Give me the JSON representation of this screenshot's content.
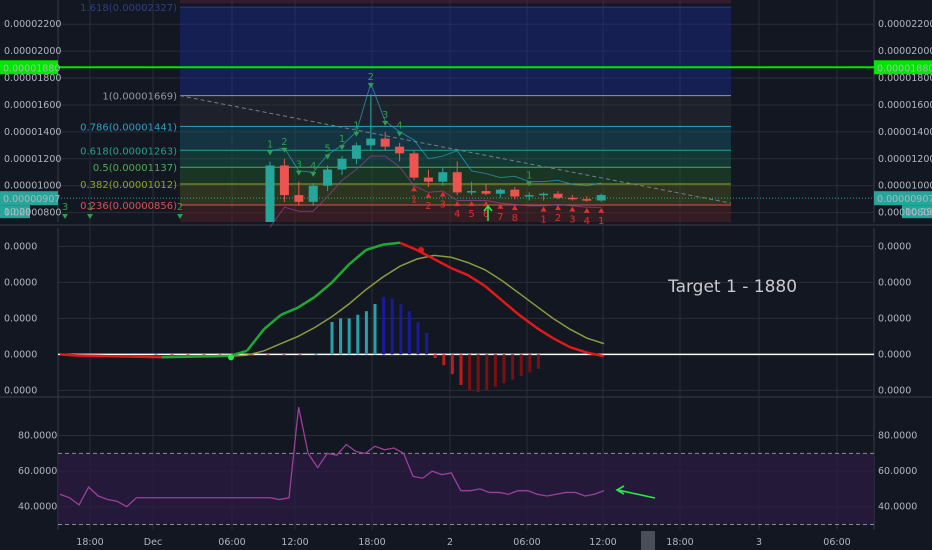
{
  "annotation": "Target 1 - 1880",
  "colors": {
    "background": "#131722",
    "grid": "#2a2e39",
    "bull": "#26a69a",
    "bear": "#ef5350",
    "target_line": "#00e600",
    "price_badge": "#26a69a",
    "macd_line_up": "#1eaa32",
    "macd_line_down": "#e01919",
    "signal_line": "#8c9a3c",
    "rsi": "#9c3f9c"
  },
  "chart_data": [
    {
      "type": "candlestick",
      "pane": "price",
      "y_ticks": [
        "0.00002200",
        "0.00002000",
        "0.00001800",
        "0.00001600",
        "0.00001400",
        "0.00001200",
        "0.00001000",
        "0.00000800"
      ],
      "ylim": [
        7.3e-06,
        2.38e-05
      ],
      "target_line": {
        "value": 1.88e-05,
        "label": "0.00001880"
      },
      "last_price": {
        "value": 9.07e-06,
        "label": "0.00000907"
      },
      "countdown": "10:29",
      "fib_levels": [
        {
          "label": "1.618(0.00002327)",
          "value": 2.327e-05,
          "color": "#2f3d8c"
        },
        {
          "label": "1(0.00001669)",
          "value": 1.669e-05,
          "color": "#9598a1"
        },
        {
          "label": "0.786(0.00001441)",
          "value": 1.441e-05,
          "color": "#2aa1c0"
        },
        {
          "label": "0.618(0.00001263)",
          "value": 1.263e-05,
          "color": "#20a48c"
        },
        {
          "label": "0.5(0.00001137)",
          "value": 1.137e-05,
          "color": "#4caf50"
        },
        {
          "label": "0.382(0.00001012)",
          "value": 1.012e-05,
          "color": "#8ca82e"
        },
        {
          "label": "0.236(0.00000856)",
          "value": 8.56e-06,
          "color": "#e05050"
        }
      ],
      "candles": [
        {
          "o": 7.3e-06,
          "h": 1.18e-05,
          "l": 7.3e-06,
          "c": 1.15e-05
        },
        {
          "o": 1.15e-05,
          "h": 1.2e-05,
          "l": 8.8e-06,
          "c": 9.3e-06
        },
        {
          "o": 9.3e-06,
          "h": 1.03e-05,
          "l": 8.5e-06,
          "c": 8.8e-06
        },
        {
          "o": 8.8e-06,
          "h": 1.02e-05,
          "l": 8.5e-06,
          "c": 1e-05
        },
        {
          "o": 1e-05,
          "h": 1.15e-05,
          "l": 9.6e-06,
          "c": 1.12e-05
        },
        {
          "o": 1.12e-05,
          "h": 1.22e-05,
          "l": 1.08e-05,
          "c": 1.2e-05
        },
        {
          "o": 1.2e-05,
          "h": 1.32e-05,
          "l": 1.16e-05,
          "c": 1.3e-05
        },
        {
          "o": 1.3e-05,
          "h": 1.68e-05,
          "l": 1.26e-05,
          "c": 1.35e-05
        },
        {
          "o": 1.35e-05,
          "h": 1.4e-05,
          "l": 1.26e-05,
          "c": 1.29e-05
        },
        {
          "o": 1.29e-05,
          "h": 1.32e-05,
          "l": 1.18e-05,
          "c": 1.24e-05
        },
        {
          "o": 1.24e-05,
          "h": 1.26e-05,
          "l": 1.04e-05,
          "c": 1.06e-05
        },
        {
          "o": 1.06e-05,
          "h": 1.12e-05,
          "l": 9.9e-06,
          "c": 1.03e-05
        },
        {
          "o": 1.03e-05,
          "h": 1.14e-05,
          "l": 1e-05,
          "c": 1.1e-05
        },
        {
          "o": 1.1e-05,
          "h": 1.18e-05,
          "l": 9.3e-06,
          "c": 9.5e-06
        },
        {
          "o": 9.5e-06,
          "h": 1.03e-05,
          "l": 9.3e-06,
          "c": 9.6e-06
        },
        {
          "o": 9.6e-06,
          "h": 1.01e-05,
          "l": 9.3e-06,
          "c": 9.4e-06
        },
        {
          "o": 9.4e-06,
          "h": 9.8e-06,
          "l": 9.1e-06,
          "c": 9.7e-06
        },
        {
          "o": 9.7e-06,
          "h": 9.9e-06,
          "l": 9e-06,
          "c": 9.2e-06
        },
        {
          "o": 9.2e-06,
          "h": 9.5e-06,
          "l": 8.9e-06,
          "c": 9.3e-06
        },
        {
          "o": 9.3e-06,
          "h": 9.5e-06,
          "l": 8.9e-06,
          "c": 9.4e-06
        },
        {
          "o": 9.4e-06,
          "h": 9.6e-06,
          "l": 9e-06,
          "c": 9.1e-06
        },
        {
          "o": 9.1e-06,
          "h": 9.3e-06,
          "l": 8.9e-06,
          "c": 9e-06
        },
        {
          "o": 9e-06,
          "h": 9.2e-06,
          "l": 8.8e-06,
          "c": 8.9e-06
        },
        {
          "o": 8.9e-06,
          "h": 9.4e-06,
          "l": 8.8e-06,
          "c": 9.3e-06
        }
      ],
      "markers": [
        {
          "i": 0,
          "kind": "bull",
          "text": "1"
        },
        {
          "i": 1,
          "kind": "bull",
          "text": "2"
        },
        {
          "i": 2,
          "kind": "bull",
          "text": "3"
        },
        {
          "i": 3,
          "kind": "bull",
          "text": "4"
        },
        {
          "i": 4,
          "kind": "bull",
          "text": "5"
        },
        {
          "i": 5,
          "kind": "bull",
          "text": "1"
        },
        {
          "i": 6,
          "kind": "bull",
          "text": "1"
        },
        {
          "i": 7,
          "kind": "bull",
          "text": "2"
        },
        {
          "i": 8,
          "kind": "bull",
          "text": "3"
        },
        {
          "i": 9,
          "kind": "bull",
          "text": "4"
        },
        {
          "i": 10,
          "kind": "bear",
          "text": "1"
        },
        {
          "i": 11,
          "kind": "bear",
          "text": "2"
        },
        {
          "i": 12,
          "kind": "bear",
          "text": "3"
        },
        {
          "i": 13,
          "kind": "bear",
          "text": "4"
        },
        {
          "i": 14,
          "kind": "bear",
          "text": "5"
        },
        {
          "i": 15,
          "kind": "bear",
          "text": "6"
        },
        {
          "i": 16,
          "kind": "bear",
          "text": "7"
        },
        {
          "i": 17,
          "kind": "bear",
          "text": "8"
        },
        {
          "i": 18,
          "kind": "bull",
          "text": "1"
        },
        {
          "i": 19,
          "kind": "bear",
          "text": "1"
        },
        {
          "i": 20,
          "kind": "bear",
          "text": "2"
        },
        {
          "i": 21,
          "kind": "bear",
          "text": "3"
        },
        {
          "i": 22,
          "kind": "bear",
          "text": "4"
        },
        {
          "i": 23,
          "kind": "bear",
          "text": "1"
        }
      ],
      "left_markers": [
        "3",
        "1",
        "2"
      ]
    },
    {
      "type": "macd",
      "pane": "macd",
      "y_ticks": [
        "0.0000",
        "0.0000",
        "0.0000",
        "0.0000",
        "0.0000",
        "-0.0000"
      ],
      "ylim": [
        -1.1,
        3.4
      ],
      "macd": [
        0,
        -0.03,
        -0.04,
        -0.05,
        -0.06,
        -0.07,
        -0.08,
        -0.07,
        -0.06,
        -0.05,
        -0.04,
        0.1,
        0.7,
        1.1,
        1.3,
        1.6,
        2.0,
        2.5,
        2.9,
        3.05,
        3.1,
        2.9,
        2.65,
        2.4,
        2.2,
        1.9,
        1.5,
        1.1,
        0.75,
        0.45,
        0.2,
        0.05,
        -0.05
      ],
      "signal": [
        0,
        -0.02,
        -0.03,
        -0.04,
        -0.05,
        -0.06,
        -0.07,
        -0.07,
        -0.06,
        -0.05,
        -0.05,
        -0.02,
        0.1,
        0.3,
        0.5,
        0.75,
        1.05,
        1.4,
        1.8,
        2.15,
        2.45,
        2.65,
        2.75,
        2.7,
        2.55,
        2.35,
        2.05,
        1.7,
        1.35,
        1.0,
        0.7,
        0.45,
        0.3
      ],
      "histogram": [
        0.02,
        -0.05,
        -0.04,
        -0.05,
        -0.04,
        -0.05,
        -0.04,
        -0.03,
        -0.03,
        -0.02,
        0.02,
        0.9,
        1.0,
        1.0,
        1.1,
        1.2,
        1.4,
        1.6,
        1.55,
        1.4,
        1.2,
        0.9,
        0.6,
        -0.1,
        -0.3,
        -0.55,
        -0.85,
        -1.0,
        -1.05,
        -1.0,
        -0.9,
        -0.8,
        -0.7,
        -0.6,
        -0.5,
        -0.4
      ]
    },
    {
      "type": "line",
      "pane": "rsi",
      "y_ticks": [
        "80.0000",
        "60.0000",
        "40.0000"
      ],
      "ylim": [
        28,
        100
      ],
      "bands": [
        30,
        70
      ],
      "values": [
        47,
        45,
        41,
        51,
        46,
        44,
        43,
        40,
        45,
        45,
        45,
        45,
        45,
        45,
        45,
        45,
        45,
        45,
        45,
        45,
        45,
        45,
        45,
        44,
        45,
        96,
        70,
        62,
        70,
        69,
        75,
        71,
        70,
        74,
        72,
        73,
        70,
        57,
        56,
        60,
        58,
        59,
        49,
        49,
        50,
        48,
        48,
        47,
        49,
        49,
        47,
        46,
        47,
        48,
        48,
        46,
        47,
        49
      ]
    }
  ],
  "x_labels": [
    "18:00",
    "Dec",
    "06:00",
    "12:00",
    "18:00",
    "2",
    "06:00",
    "12:00",
    "18:00",
    "3",
    "06:00"
  ]
}
